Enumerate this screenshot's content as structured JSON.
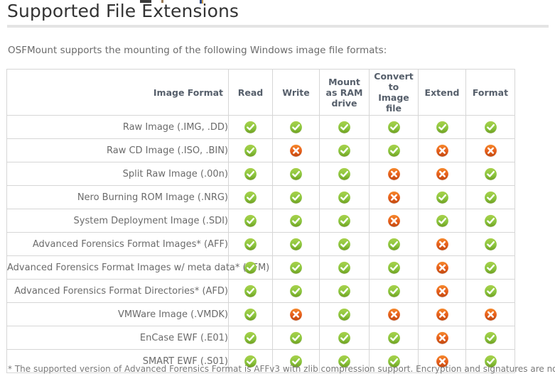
{
  "page": {
    "title": "Supported File Extensions",
    "intro": "OSFMount supports the mounting of the following Windows image file formats:",
    "footnote": "* The supported version of Advanced Forensics Format is AFFv3 with zlib compression support. Encryption and signatures are not supported."
  },
  "colors": {
    "check_green": "#8CC63F",
    "check_green_dark": "#6FA020",
    "cross_orange": "#E8601C",
    "cross_orange_dark": "#C24A10",
    "header_text": "#565F6B",
    "body_text": "#6B6B6B",
    "title_text": "#333333",
    "border": "#D6D6D6",
    "divider": "#E4E4E4"
  },
  "table": {
    "headers": [
      "Image Format",
      "Read",
      "Write",
      "Mount as RAM drive",
      "Convert to Image file",
      "Extend",
      "Format"
    ],
    "rows": [
      {
        "name": "Raw Image (.IMG, .DD)",
        "read": "yes",
        "write": "yes",
        "ram": "yes",
        "convert": "yes",
        "extend": "yes",
        "format": "yes"
      },
      {
        "name": "Raw CD Image (.ISO, .BIN)",
        "read": "yes",
        "write": "no",
        "ram": "yes",
        "convert": "yes",
        "extend": "no",
        "format": "no"
      },
      {
        "name": "Split Raw Image (.00n)",
        "read": "yes",
        "write": "yes",
        "ram": "yes",
        "convert": "no",
        "extend": "no",
        "format": "yes"
      },
      {
        "name": "Nero Burning ROM Image (.NRG)",
        "read": "yes",
        "write": "yes",
        "ram": "yes",
        "convert": "no",
        "extend": "yes",
        "format": "yes"
      },
      {
        "name": "System Deployment Image (.SDI)",
        "read": "yes",
        "write": "yes",
        "ram": "yes",
        "convert": "no",
        "extend": "yes",
        "format": "yes"
      },
      {
        "name": "Advanced Forensics Format Images* (AFF)",
        "read": "yes",
        "write": "yes",
        "ram": "yes",
        "convert": "yes",
        "extend": "no",
        "format": "yes"
      },
      {
        "name": "Advanced Forensics Format Images w/ meta data* (AFM)",
        "read": "yes",
        "write": "yes",
        "ram": "yes",
        "convert": "yes",
        "extend": "no",
        "format": "yes"
      },
      {
        "name": "Advanced Forensics Format Directories* (AFD)",
        "read": "yes",
        "write": "yes",
        "ram": "yes",
        "convert": "yes",
        "extend": "no",
        "format": "yes"
      },
      {
        "name": "VMWare Image (.VMDK)",
        "read": "yes",
        "write": "no",
        "ram": "yes",
        "convert": "no",
        "extend": "no",
        "format": "no"
      },
      {
        "name": "EnCase EWF (.E01)",
        "read": "yes",
        "write": "yes",
        "ram": "yes",
        "convert": "yes",
        "extend": "no",
        "format": "yes"
      },
      {
        "name": "SMART EWF (.S01)",
        "read": "yes",
        "write": "yes",
        "ram": "yes",
        "convert": "yes",
        "extend": "no",
        "format": "yes"
      }
    ]
  },
  "icons": {
    "yes": "check-circle-green-icon",
    "no": "cross-circle-red-icon"
  }
}
